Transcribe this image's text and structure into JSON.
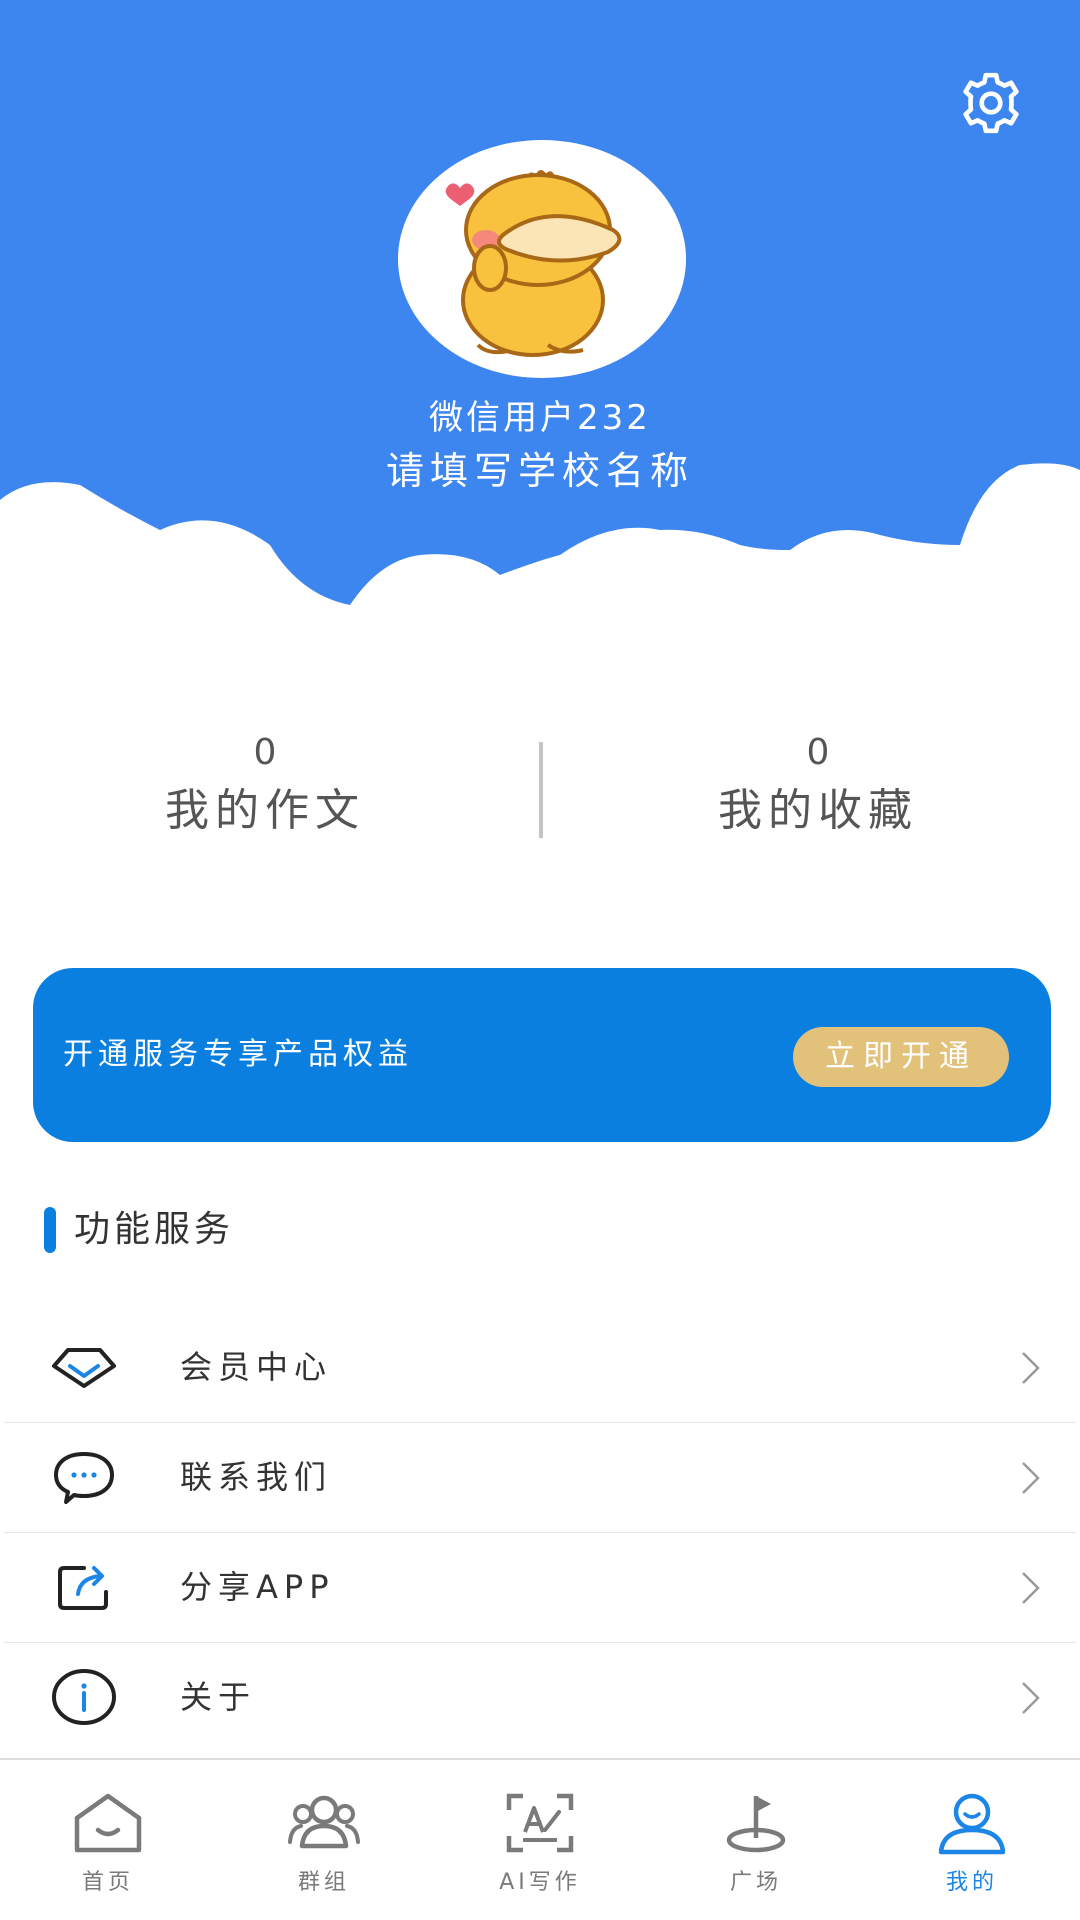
{
  "profile": {
    "username": "微信用户232",
    "school": "请填写学校名称"
  },
  "stats": {
    "essays": {
      "value": "0",
      "label": "我的作文"
    },
    "favorites": {
      "value": "0",
      "label": "我的收藏"
    }
  },
  "promo": {
    "text": "开通服务专享产品权益",
    "button_label": "立即开通"
  },
  "section": {
    "title": "功能服务"
  },
  "menu": [
    {
      "label": "会员中心",
      "icon": "diamond-icon"
    },
    {
      "label": "联系我们",
      "icon": "chat-bubble-icon"
    },
    {
      "label": "分享APP",
      "icon": "share-icon"
    },
    {
      "label": "关于",
      "icon": "info-icon"
    }
  ],
  "tabbar": [
    {
      "label": "首页",
      "icon": "home-icon",
      "active": false
    },
    {
      "label": "群组",
      "icon": "group-icon",
      "active": false
    },
    {
      "label": "AI写作",
      "icon": "ai-write-icon",
      "active": false
    },
    {
      "label": "广场",
      "icon": "plaza-flag-icon",
      "active": false
    },
    {
      "label": "我的",
      "icon": "profile-icon",
      "active": true
    }
  ],
  "colors": {
    "header_blue": "#3d86ef",
    "promo_blue": "#0a7fe0",
    "promo_button_gold": "#e2c27b",
    "active_tab_blue": "#1b86e6",
    "divider_gray": "#c4c4c4"
  }
}
